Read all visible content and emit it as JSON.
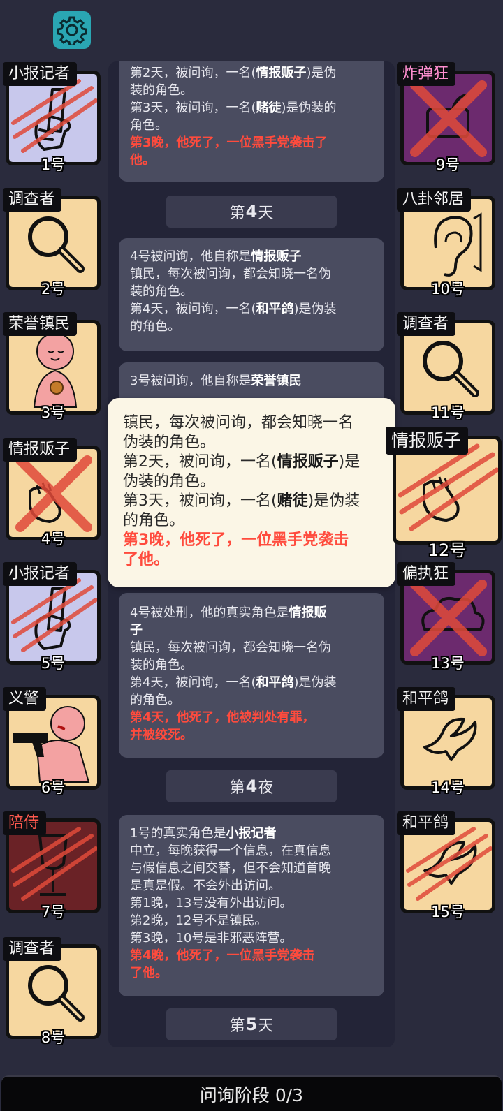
{
  "settings": {
    "icon": "gear-icon",
    "color": "#2aa6b3"
  },
  "players_left": [
    {
      "role": "小报记者",
      "number": "1号",
      "top": 0,
      "bg": "lavender",
      "dead": true
    },
    {
      "role": "调查者",
      "number": "2号"
    },
    {
      "role": "荣誉镇民",
      "number": "3号"
    },
    {
      "role": "情报贩子",
      "number": "4号",
      "dead": true
    },
    {
      "role": "小报记者",
      "number": "5号",
      "dead": true
    },
    {
      "role": "义警",
      "number": "6号"
    },
    {
      "role": "陪侍",
      "number": "7号",
      "dead": true
    },
    {
      "role": "调查者",
      "number": "8号"
    }
  ],
  "players_right": [
    {
      "role": "炸弹狂",
      "number": "9号",
      "dead": true
    },
    {
      "role": "八卦邻居",
      "number": "10号"
    },
    {
      "role": "调查者",
      "number": "11号"
    },
    {
      "role": "情报贩子",
      "number": "12号",
      "dead": true
    },
    {
      "role": "偏执狂",
      "number": "13号",
      "dead": true
    },
    {
      "role": "和平鸽",
      "number": "14号"
    },
    {
      "role": "和平鸽",
      "number": "15号",
      "dead": true
    }
  ],
  "log": {
    "card1": {
      "l1a": "第2天，被问询，一名(",
      "l1b": "情报贩子",
      "l1c": ")是伪",
      "l2": "装的角色。",
      "l3a": "第3天，被问询，一名(",
      "l3b": "赌徒",
      "l3c": ")是伪装的",
      "l4": "角色。",
      "red1": "第3晚，他死了，一位黑手党袭击了",
      "red2": "他。"
    },
    "day4": {
      "prefix": "第",
      "num": "4",
      "suffix": "天"
    },
    "card2": {
      "l1a": "4号被问询，他自称是",
      "l1b": "情报贩子",
      "l2": "镇民，每次被问询，都会知晓一名伪",
      "l3": "装的角色。",
      "l4a": "第4天，被问询，一名(",
      "l4b": "和平鸽",
      "l4c": ")是伪装",
      "l5": "的角色。"
    },
    "card3": {
      "l1a": "3号被问询，他自称是",
      "l1b": "荣誉镇民",
      "l2": "…"
    },
    "card4": {
      "l1a": "4号被处刑，他的真实角色是",
      "l1b": "情报贩",
      "l2": "子",
      "l3": "镇民，每次被问询，都会知晓一名伪",
      "l4": "装的角色。",
      "l5a": "第4天，被问询，一名(",
      "l5b": "和平鸽",
      "l5c": ")是伪装",
      "l6": "的角色。",
      "red1": "第4天，他死了，他被判处有罪，",
      "red2": "并被绞死。"
    },
    "night4": {
      "prefix": "第",
      "num": "4",
      "suffix": "夜"
    },
    "card5": {
      "l1a": "1号的真实角色是",
      "l1b": "小报记者",
      "l2": "中立，每晚获得一个信息，在真信息",
      "l3": "与假信息之间交替，但不会知道首晚",
      "l4": "是真是假。不会外出访问。",
      "l5": "第1晚，13号没有外出访问。",
      "l6": "第2晚，12号不是镇民。",
      "l7": "第3晚，10号是非邪恶阵营。",
      "red1": "第4晚，他死了，一位黑手党袭击",
      "red2": "了他。"
    },
    "day5": {
      "prefix": "第",
      "num": "5",
      "suffix": "天"
    }
  },
  "tooltip": {
    "l1": "镇民，每次被问询，都会知晓一名",
    "l2": "伪装的角色。",
    "l3a": "第2天，被问询，一名(",
    "l3b": "情报贩子",
    "l3c": ")是",
    "l4": "伪装的角色。",
    "l5a": "第3天，被问询，一名(",
    "l5b": "赌徒",
    "l5c": ")是伪装",
    "l6": "的角色。",
    "red1": "第3晚，他死了，一位黑手党袭击",
    "red2": "了他。"
  },
  "bottom_bar": {
    "label": "问询阶段 0/3"
  },
  "colors": {
    "accent_red": "#ff4b3d",
    "card_bg": "#f6d7a0",
    "panel": "#232437"
  }
}
